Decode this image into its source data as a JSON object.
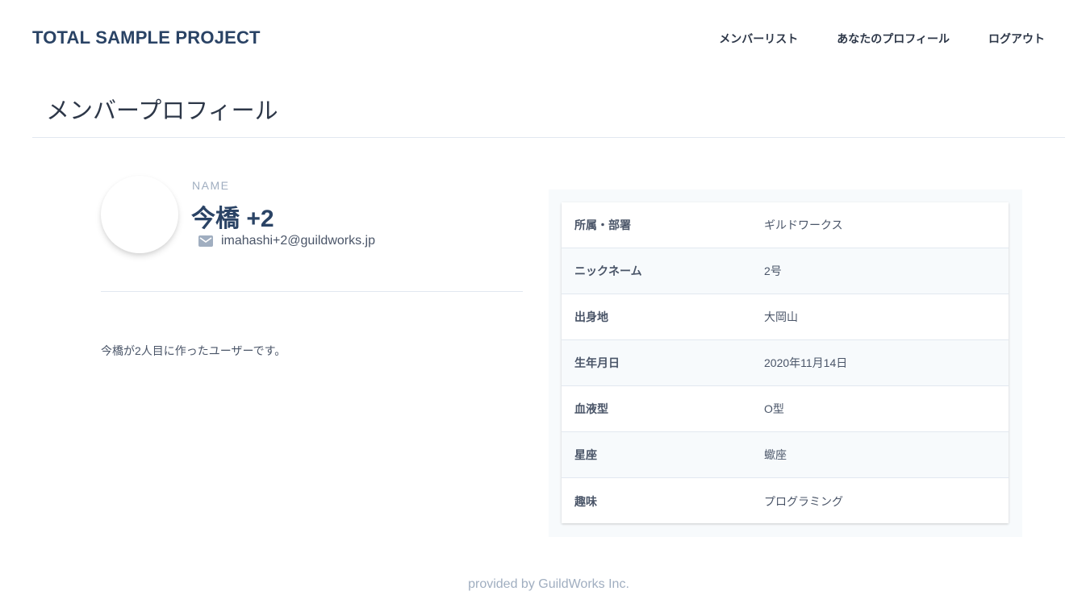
{
  "header": {
    "brand": "TOTAL SAMPLE PROJECT",
    "nav": [
      {
        "label": "メンバーリスト"
      },
      {
        "label": "あなたのプロフィール"
      },
      {
        "label": "ログアウト"
      }
    ]
  },
  "page": {
    "title": "メンバープロフィール"
  },
  "profile": {
    "name_label": "NAME",
    "name": "今橋 +2",
    "email_icon": "mail-icon",
    "email": "imahashi+2@guildworks.jp",
    "bio": "今橋が2人目に作ったユーザーです。"
  },
  "info": {
    "rows": [
      {
        "key": "所属・部署",
        "value": "ギルドワークス"
      },
      {
        "key": "ニックネーム",
        "value": "2号"
      },
      {
        "key": "出身地",
        "value": "大岡山"
      },
      {
        "key": "生年月日",
        "value": "2020年11月14日"
      },
      {
        "key": "血液型",
        "value": "O型"
      },
      {
        "key": "星座",
        "value": "蠍座"
      },
      {
        "key": "趣味",
        "value": "プログラミング"
      }
    ]
  },
  "footer": {
    "text": "provided by GuildWorks Inc."
  },
  "colors": {
    "brand": "#2a4365",
    "text": "#2d3748",
    "muted": "#a0aec0",
    "panel_bg": "#f7fafc",
    "divider": "#e2e8f0"
  }
}
